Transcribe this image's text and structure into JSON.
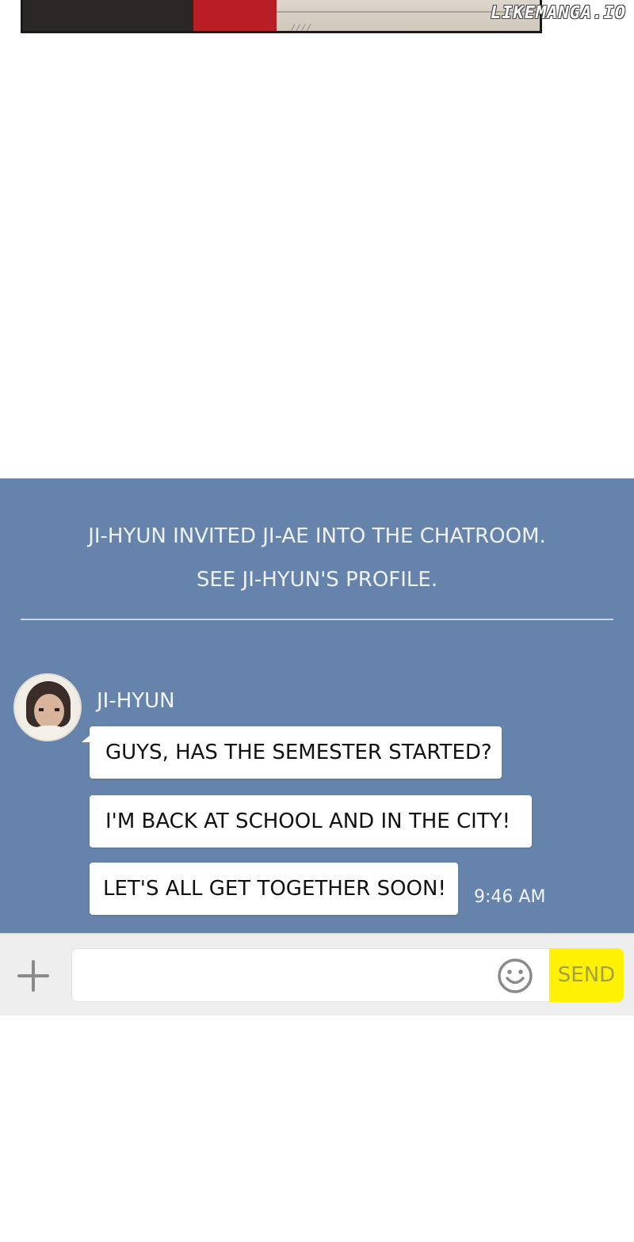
{
  "watermark": "LIKEMANGA.IO",
  "panel": {
    "hatch_text": "////"
  },
  "chat": {
    "system_messages": [
      "JI-HYUN INVITED JI-AE INTO THE CHATROOM.",
      "SEE JI-HYUN'S PROFILE."
    ],
    "sender": "JI-HYUN",
    "messages": [
      "GUYS, HAS THE SEMESTER STARTED?",
      "I'M BACK AT SCHOOL AND IN THE CITY!",
      "LET'S ALL GET TOGETHER SOON!"
    ],
    "timestamp": "9:46 AM"
  },
  "input_bar": {
    "attach_icon": "plus-icon",
    "message_value": "",
    "emoji_icon": "smiley-icon",
    "send_label": "SEND"
  },
  "colors": {
    "chat_background": "#6684ab",
    "send_button": "#fef102",
    "send_text": "#a2a048",
    "bubble": "#ffffff"
  }
}
